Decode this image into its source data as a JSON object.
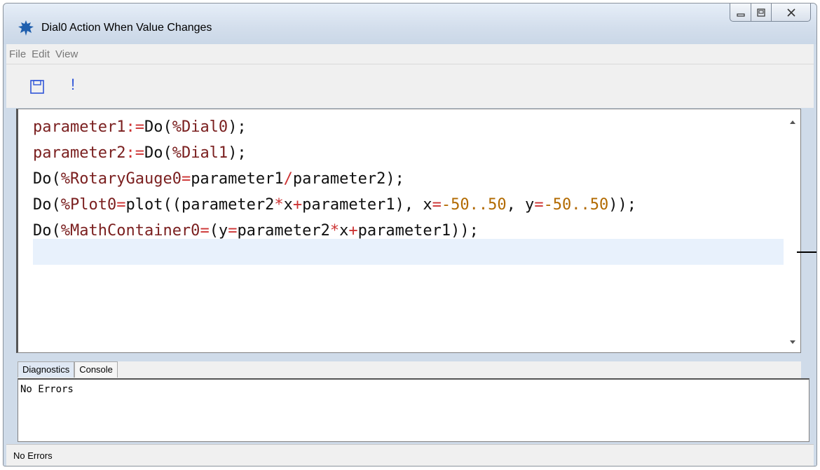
{
  "window": {
    "title": "Dial0 Action When Value Changes",
    "icon": "maple-leaf-icon"
  },
  "menu": {
    "file": "File",
    "edit": "Edit",
    "view": "View"
  },
  "toolbar": {
    "save_icon": "save-icon",
    "run_label": "!"
  },
  "editor": {
    "lines": [
      [
        [
          "var",
          "parameter1"
        ],
        [
          "op",
          ":="
        ],
        [
          "txt",
          "Do("
        ],
        [
          "var",
          "%Dial0"
        ],
        [
          "txt",
          ");"
        ]
      ],
      [
        [
          "var",
          "parameter2"
        ],
        [
          "op",
          ":="
        ],
        [
          "txt",
          "Do("
        ],
        [
          "var",
          "%Dial1"
        ],
        [
          "txt",
          ");"
        ]
      ],
      [
        [
          "txt",
          "Do("
        ],
        [
          "var",
          "%RotaryGauge0"
        ],
        [
          "op",
          "="
        ],
        [
          "txt",
          "parameter1"
        ],
        [
          "op",
          "/"
        ],
        [
          "txt",
          "parameter2);"
        ]
      ],
      [
        [
          "txt",
          "Do("
        ],
        [
          "var",
          "%Plot0"
        ],
        [
          "op",
          "="
        ],
        [
          "txt",
          "plot((parameter2"
        ],
        [
          "op",
          "*"
        ],
        [
          "txt",
          "x"
        ],
        [
          "op",
          "+"
        ],
        [
          "txt",
          "parameter1), x"
        ],
        [
          "op",
          "="
        ],
        [
          "num",
          "-50..50"
        ],
        [
          "txt",
          ", y"
        ],
        [
          "op",
          "="
        ],
        [
          "num",
          "-50..50"
        ],
        [
          "txt",
          "));"
        ]
      ],
      [
        [
          "txt",
          "Do("
        ],
        [
          "var",
          "%MathContainer0"
        ],
        [
          "op",
          "="
        ],
        [
          "txt",
          "(y"
        ],
        [
          "op",
          "="
        ],
        [
          "txt",
          "parameter2"
        ],
        [
          "op",
          "*"
        ],
        [
          "txt",
          "x"
        ],
        [
          "op",
          "+"
        ],
        [
          "txt",
          "parameter1));"
        ]
      ]
    ]
  },
  "tabs": {
    "diagnostics": "Diagnostics",
    "console": "Console"
  },
  "diagnostics": {
    "text": "No Errors"
  },
  "status": {
    "text": "No Errors"
  }
}
